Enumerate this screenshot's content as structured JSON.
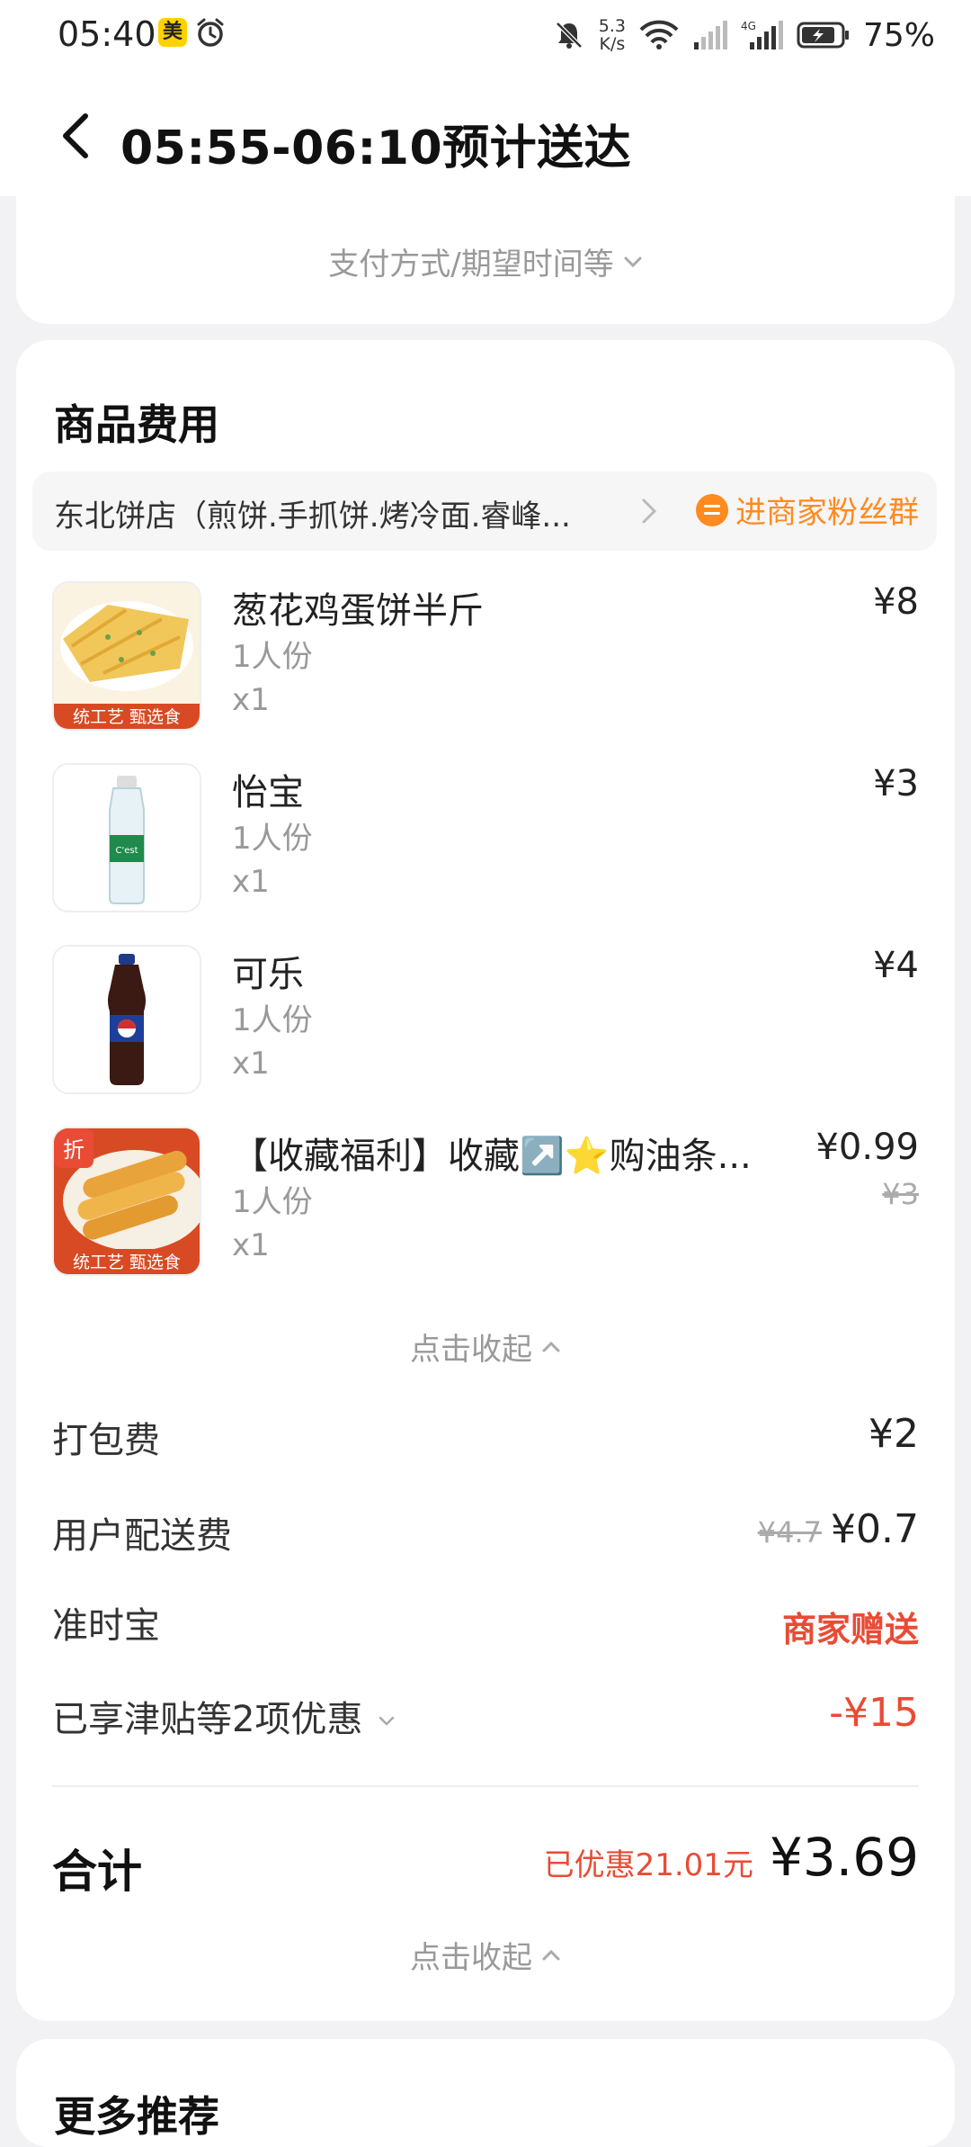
{
  "status_bar": {
    "time": "05:40",
    "app_badge": "美",
    "net_speed_value": "5.3",
    "net_speed_unit": "K/s",
    "battery": "75%"
  },
  "nav": {
    "title": "05:55-06:10预计送达"
  },
  "top_card": {
    "collapse_text": "支付方式/期望时间等"
  },
  "fee_section": {
    "title": "商品费用",
    "shop_name": "东北饼店（煎饼.手抓饼.烤冷面.睿峰...",
    "fan_group": "进商家粉丝群",
    "items": [
      {
        "name": "葱花鸡蛋饼半斤",
        "spec": "1人份",
        "qty": "x1",
        "price": "¥8",
        "image": "scallion-egg-pancake"
      },
      {
        "name": "怡宝",
        "spec": "1人份",
        "qty": "x1",
        "price": "¥3",
        "image": "water-bottle"
      },
      {
        "name": "可乐",
        "spec": "1人份",
        "qty": "x1",
        "price": "¥4",
        "image": "cola-bottle"
      },
      {
        "name": "【收藏福利】收藏↗️⭐购油条...",
        "spec": "1人份",
        "qty": "x1",
        "price": "¥0.99",
        "orig_price": "¥3",
        "image": "fried-dough-sticks",
        "discount_tag": "折"
      }
    ],
    "collapse_items": "点击收起",
    "thumb_banner": "统工艺 甄选食",
    "fees": {
      "packing_label": "打包费",
      "packing_value": "¥2",
      "delivery_label": "用户配送费",
      "delivery_orig": "¥4.7",
      "delivery_value": "¥0.7",
      "ontime_label": "准时宝",
      "ontime_value": "商家赠送",
      "discount_label": "已享津贴等2项优惠",
      "discount_value": "-¥15"
    },
    "total": {
      "label": "合计",
      "saved": "已优惠21.01元",
      "amount": "¥3.69"
    },
    "collapse_total": "点击收起"
  },
  "recommend": {
    "title": "更多推荐"
  },
  "colors": {
    "accent_orange": "#ff8a1f",
    "price_red": "#e94b35",
    "background": "#f2f2f4"
  }
}
